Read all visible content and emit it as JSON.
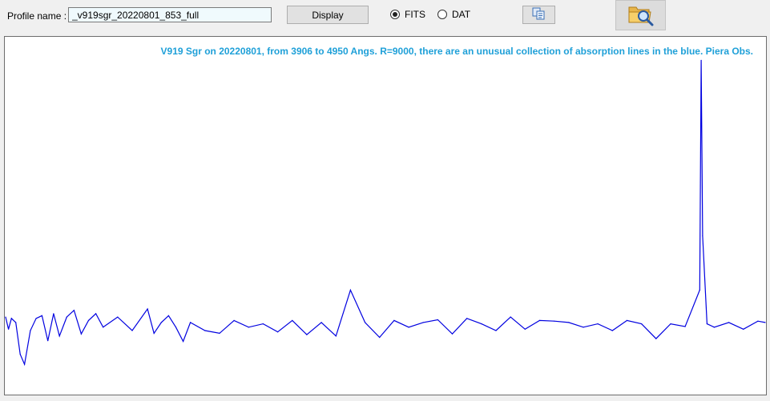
{
  "profile": {
    "label": "Profile name :",
    "value": "_v919sgr_20220801_853_full"
  },
  "buttons": {
    "display": "Display"
  },
  "format": {
    "options": [
      "FITS",
      "DAT"
    ],
    "selected": "FITS"
  },
  "icons": {
    "copy": "copy-icon",
    "open": "folder-search-icon"
  },
  "colors": {
    "spectrum": "#0000e0",
    "title": "#1fa0d8"
  },
  "chart_data": {
    "type": "line",
    "title": "V919 Sgr on 20220801, from 3906 to 4950 Angs. R=9000, there are an unusual collection of absorption lines in the blue. Piera Obs.",
    "xlabel": "",
    "ylabel": "",
    "xlim": [
      3906,
      4950
    ],
    "ylim": [
      0,
      5.2
    ],
    "grid": false,
    "x": [
      3906,
      3910,
      3914,
      3920,
      3926,
      3932,
      3940,
      3948,
      3956,
      3964,
      3972,
      3980,
      3990,
      4000,
      4010,
      4020,
      4030,
      4040,
      4060,
      4080,
      4101,
      4110,
      4120,
      4130,
      4140,
      4150,
      4160,
      4180,
      4200,
      4220,
      4240,
      4260,
      4280,
      4300,
      4320,
      4340,
      4360,
      4380,
      4400,
      4420,
      4440,
      4460,
      4480,
      4500,
      4520,
      4540,
      4560,
      4580,
      4600,
      4620,
      4640,
      4660,
      4680,
      4700,
      4720,
      4740,
      4760,
      4780,
      4800,
      4820,
      4840,
      4860,
      4862,
      4864,
      4870,
      4880,
      4900,
      4920,
      4940,
      4950
    ],
    "y": [
      1.1,
      0.92,
      1.08,
      1.02,
      0.55,
      0.4,
      0.9,
      1.08,
      1.12,
      0.75,
      1.15,
      0.82,
      1.1,
      1.2,
      0.85,
      1.05,
      1.15,
      0.95,
      1.1,
      0.9,
      1.22,
      0.86,
      1.02,
      1.12,
      0.95,
      0.74,
      1.02,
      0.9,
      0.86,
      1.05,
      0.95,
      1.0,
      0.88,
      1.05,
      0.84,
      1.02,
      0.82,
      1.5,
      1.02,
      0.8,
      1.05,
      0.95,
      1.02,
      1.06,
      0.85,
      1.08,
      1.0,
      0.9,
      1.1,
      0.92,
      1.05,
      1.04,
      1.02,
      0.95,
      1.0,
      0.9,
      1.05,
      1.0,
      0.78,
      1.0,
      0.96,
      1.5,
      4.9,
      2.3,
      1.0,
      0.95,
      1.02,
      0.92,
      1.04,
      1.02
    ]
  }
}
